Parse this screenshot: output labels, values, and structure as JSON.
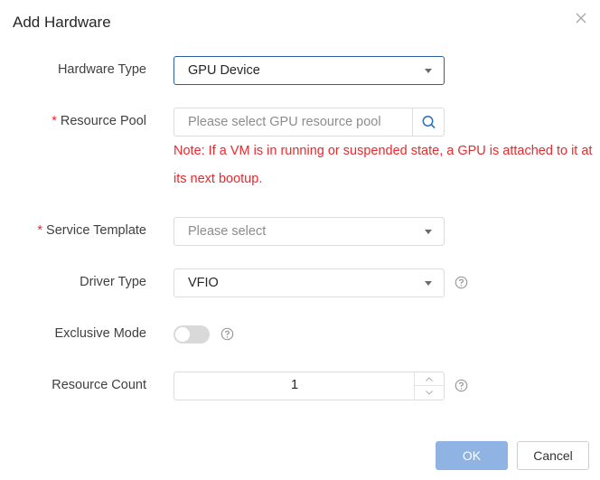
{
  "dialog": {
    "title": "Add Hardware",
    "close_icon": "close-icon"
  },
  "form": {
    "hardware_type": {
      "label": "Hardware Type",
      "value": "GPU Device"
    },
    "resource_pool": {
      "required_mark": "*",
      "label": "Resource Pool",
      "placeholder": "Please select GPU resource pool",
      "value": "",
      "search_icon": "search-icon",
      "note": "Note: If a VM is in running or suspended state, a GPU is attached to it at its next bootup."
    },
    "service_template": {
      "required_mark": "*",
      "label": "Service Template",
      "placeholder": "Please select"
    },
    "driver_type": {
      "label": "Driver Type",
      "value": "VFIO",
      "help_icon": "help-icon"
    },
    "exclusive_mode": {
      "label": "Exclusive Mode",
      "enabled": false,
      "help_icon": "help-icon"
    },
    "resource_count": {
      "label": "Resource Count",
      "value": "1",
      "help_icon": "help-icon"
    }
  },
  "footer": {
    "ok_label": "OK",
    "cancel_label": "Cancel"
  },
  "colors": {
    "required": "#e8292d",
    "note": "#e8292d",
    "primary_disabled": "#8fb4e3",
    "active_border": "#2f5f9c"
  }
}
